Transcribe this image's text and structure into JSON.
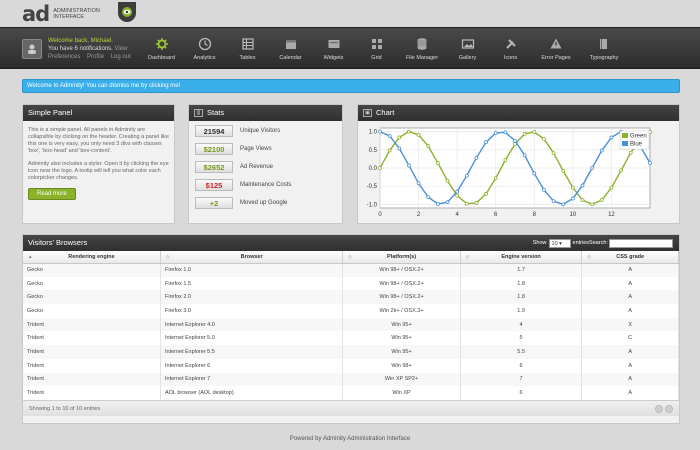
{
  "brand": {
    "mark": "ad",
    "name_line1": "ADMINISTRATION",
    "name_line2": "INTERFACE",
    "badge_icon": "eye-icon"
  },
  "user": {
    "welcome": "Welcome back, Michael.",
    "notifications": "You have 6 notifications.",
    "view": "View",
    "links": [
      "Preferences",
      "Profile",
      "Log out"
    ]
  },
  "nav": [
    {
      "label": "Dashboard",
      "icon": "gear-icon",
      "active": true
    },
    {
      "label": "Analytics",
      "icon": "clock-icon"
    },
    {
      "label": "Tables",
      "icon": "table-icon"
    },
    {
      "label": "Calendar",
      "icon": "calendar-icon"
    },
    {
      "label": "Widgets",
      "icon": "widgets-icon"
    },
    {
      "label": "Grid",
      "icon": "grid-icon"
    },
    {
      "label": "File Manager",
      "icon": "database-icon"
    },
    {
      "label": "Gallery",
      "icon": "image-icon"
    },
    {
      "label": "Icons",
      "icon": "tools-icon"
    },
    {
      "label": "Error Pages",
      "icon": "warning-icon"
    },
    {
      "label": "Typography",
      "icon": "book-icon"
    }
  ],
  "info": "Welcome to Adminity! You can dismiss me by clicking me!",
  "simple_panel": {
    "title": "Simple Panel",
    "p1": "This is a simple panel. All panels in Adminity are collapsible by clicking on the header. Creating a panel like this one is very easy, you only need 3 divs with classes 'box', 'box-head' and 'box-content'.",
    "p2": "Adminity also includes a styler. Open it by clicking the eye icon near the logo. A toolip will tell you what color each colorpicker changes.",
    "button": "Read more"
  },
  "stats": {
    "title": "Stats",
    "rows": [
      {
        "value": "21594",
        "label": "Unique Visitors",
        "color": "#333333"
      },
      {
        "value": "$2100",
        "label": "Page Views",
        "color": "#7a9a1a"
      },
      {
        "value": "$2652",
        "label": "Ad Revenue",
        "color": "#7a9a1a"
      },
      {
        "value": "$125",
        "label": "Maintenance Costs",
        "color": "#cc2222"
      },
      {
        "value": "+2",
        "label": "Moved up Google",
        "color": "#7a9a1a"
      }
    ]
  },
  "chart_panel": {
    "title": "Chart"
  },
  "chart_data": {
    "type": "line",
    "xlim": [
      0,
      14
    ],
    "ylim": [
      -1.1,
      1.1
    ],
    "xticks": [
      0,
      2,
      4,
      6,
      8,
      10,
      12
    ],
    "yticks": [
      -1.0,
      -0.5,
      0.0,
      0.5,
      1.0
    ],
    "ytick_labels": [
      "-1.0",
      "-0.5",
      "0.0",
      "0.5",
      "1.0"
    ],
    "grid": true,
    "legend": "top-right",
    "series": [
      {
        "name": "Green",
        "color": "#8ab22a",
        "x": [
          0,
          0.5,
          1,
          1.5,
          2,
          2.5,
          3,
          3.5,
          4,
          4.5,
          5,
          5.5,
          6,
          6.5,
          7,
          7.5,
          8,
          8.5,
          9,
          9.5,
          10,
          10.5,
          11,
          11.5,
          12,
          12.5,
          13,
          13.5,
          14
        ],
        "y": [
          0,
          0.48,
          0.84,
          1.0,
          0.91,
          0.6,
          0.14,
          -0.35,
          -0.76,
          -0.98,
          -0.96,
          -0.71,
          -0.28,
          0.22,
          0.66,
          0.94,
          0.99,
          0.8,
          0.41,
          -0.08,
          -0.54,
          -0.88,
          -1.0,
          -0.88,
          -0.54,
          -0.07,
          0.42,
          0.8,
          0.99
        ]
      },
      {
        "name": "Blue",
        "color": "#4a90d9",
        "x": [
          0,
          0.5,
          1,
          1.5,
          2,
          2.5,
          3,
          3.5,
          4,
          4.5,
          5,
          5.5,
          6,
          6.5,
          7,
          7.5,
          8,
          8.5,
          9,
          9.5,
          10,
          10.5,
          11,
          11.5,
          12,
          12.5,
          13,
          13.5,
          14
        ],
        "y": [
          1.0,
          0.88,
          0.54,
          0.07,
          -0.42,
          -0.8,
          -0.99,
          -0.94,
          -0.65,
          -0.21,
          0.28,
          0.71,
          0.96,
          0.98,
          0.75,
          0.35,
          -0.15,
          -0.6,
          -0.91,
          -1.0,
          -0.84,
          -0.48,
          0.0,
          0.48,
          0.84,
          1.0,
          0.91,
          0.59,
          0.14
        ]
      }
    ]
  },
  "browsers": {
    "title": "Visitors' Browsers",
    "show": "Show",
    "show_value": "10",
    "entries": "entries",
    "search": "Search:",
    "columns": [
      "Rendering engine",
      "Browser",
      "Platform(s)",
      "Engine version",
      "CSS grade"
    ],
    "rows": [
      [
        "Gecko",
        "Firefox 1.0",
        "Win 98+ / OSX.2+",
        "1.7",
        "A"
      ],
      [
        "Gecko",
        "Firefox 1.5",
        "Win 98+ / OSX.2+",
        "1.8",
        "A"
      ],
      [
        "Gecko",
        "Firefox 2.0",
        "Win 98+ / OSX.2+",
        "1.8",
        "A"
      ],
      [
        "Gecko",
        "Firefox 3.0",
        "Win 2k+ / OSX.3+",
        "1.9",
        "A"
      ],
      [
        "Trident",
        "Internet Explorer 4.0",
        "Win 95+",
        "4",
        "X"
      ],
      [
        "Trident",
        "Internet Explorer 5.0",
        "Win 95+",
        "5",
        "C"
      ],
      [
        "Trident",
        "Internet Explorer 5.5",
        "Win 95+",
        "5.5",
        "A"
      ],
      [
        "Trident",
        "Internet Explorer 6",
        "Win 98+",
        "6",
        "A"
      ],
      [
        "Trident",
        "Internet Explorer 7",
        "Win XP SP2+",
        "7",
        "A"
      ],
      [
        "Trident",
        "AOL browser (AOL desktop)",
        "Win XP",
        "6",
        "A"
      ]
    ],
    "footer": "Showing 1 to 10 of 10 entries"
  },
  "footer": "Powered by Adminity Administration Interface"
}
